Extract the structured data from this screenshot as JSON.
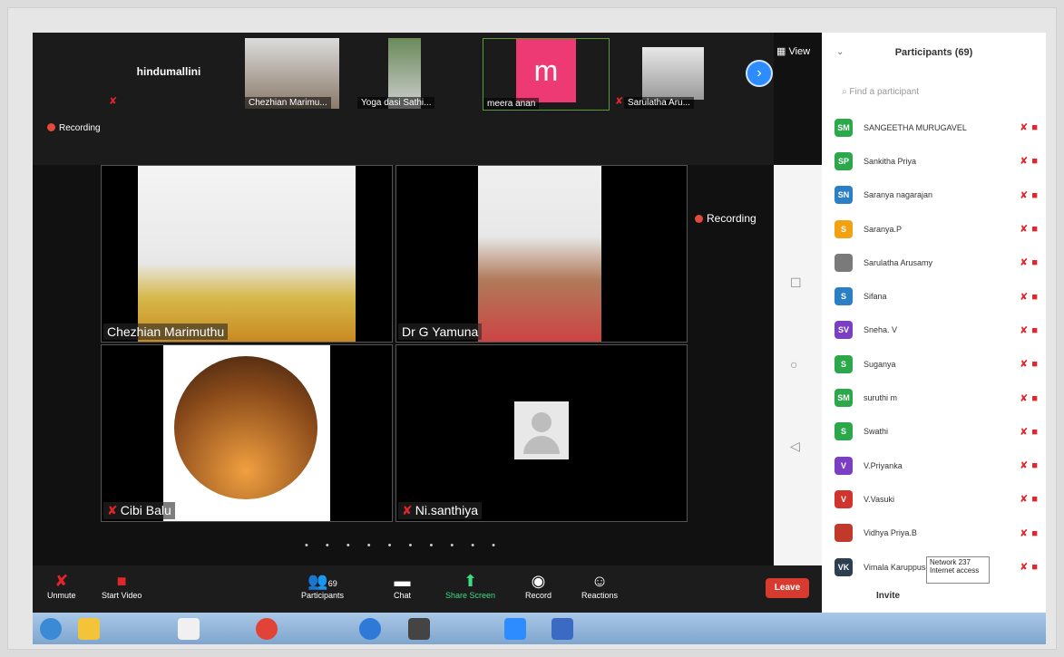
{
  "thumbnails": [
    {
      "name": "hindumallini",
      "kind": "name-only"
    },
    {
      "name": "Chezhian Marimu...",
      "kind": "video"
    },
    {
      "name": "Yoga dasi Sathi...",
      "kind": "video"
    },
    {
      "name": "meera anan",
      "kind": "avatar",
      "letter": "m"
    },
    {
      "name": "Sarulatha Aru...",
      "kind": "video"
    }
  ],
  "recording_small": "Recording",
  "recording_big": "Recording",
  "view_label": "View",
  "tiles": [
    {
      "name": "Chezhian Marimuthu",
      "muted": false
    },
    {
      "name": "Dr G Yamuna",
      "muted": false
    },
    {
      "name": "Cibi Balu",
      "muted": true
    },
    {
      "name": "Ni.santhiya",
      "muted": true
    }
  ],
  "pager_dots": "• • • • • • • • • •",
  "panel": {
    "title": "Participants (69)",
    "search_placeholder": "Find a participant",
    "invite": "Invite"
  },
  "participants": [
    {
      "initials": "SM",
      "name": "SANGEETHA MURUGAVEL",
      "color": "#2aa84a"
    },
    {
      "initials": "SP",
      "name": "Sankitha Priya",
      "color": "#2aa84a"
    },
    {
      "initials": "SN",
      "name": "Saranya nagarajan",
      "color": "#2b7fc4"
    },
    {
      "initials": "S",
      "name": "Saranya.P",
      "color": "#f2a20f"
    },
    {
      "initials": "",
      "name": "Sarulatha Arusamy",
      "color": "#7a7a7a"
    },
    {
      "initials": "S",
      "name": "Sifana",
      "color": "#2b7fc4"
    },
    {
      "initials": "SV",
      "name": "Sneha. V",
      "color": "#7b3fc4"
    },
    {
      "initials": "S",
      "name": "Suganya",
      "color": "#2aa84a"
    },
    {
      "initials": "SM",
      "name": "suruthi m",
      "color": "#2aa84a"
    },
    {
      "initials": "S",
      "name": "Swathi",
      "color": "#2aa84a"
    },
    {
      "initials": "V",
      "name": "V.Priyanka",
      "color": "#7b3fc4"
    },
    {
      "initials": "V",
      "name": "V.Vasuki",
      "color": "#d0342c"
    },
    {
      "initials": "",
      "name": "Vidhya Priya.B",
      "color": "#c0392b"
    },
    {
      "initials": "VK",
      "name": "Vimala Karuppusamy",
      "color": "#2c3e50"
    }
  ],
  "toolbar": {
    "unmute": "Unmute",
    "start_video": "Start Video",
    "participants": "Participants",
    "participants_count": "69",
    "chat": "Chat",
    "share_screen": "Share Screen",
    "record": "Record",
    "reactions": "Reactions",
    "leave": "Leave"
  },
  "network": {
    "line1": "Network 237",
    "line2": "Internet access"
  }
}
